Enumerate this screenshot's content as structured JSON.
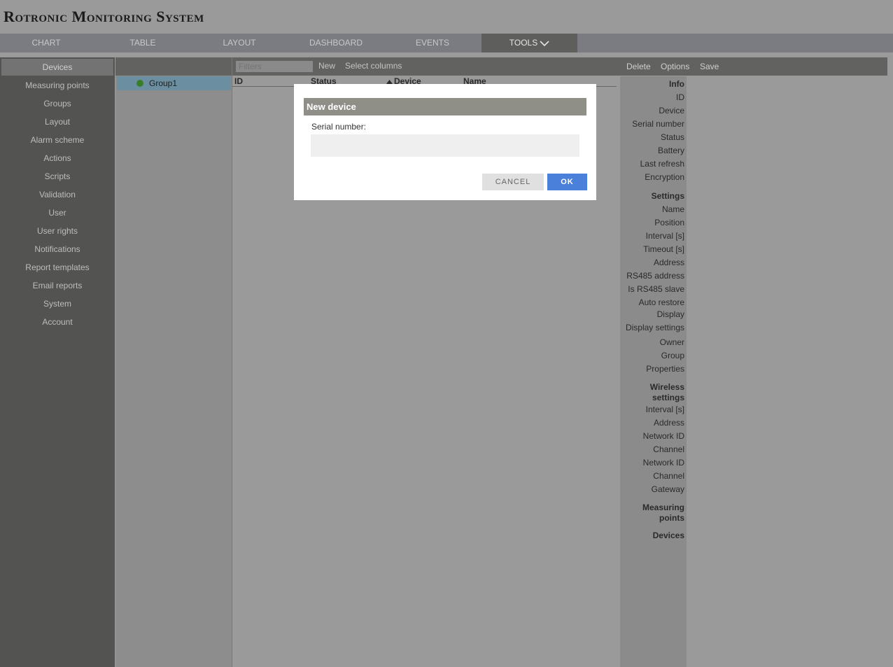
{
  "app_title": "Rotronic Monitoring System",
  "nav": {
    "tabs": [
      "CHART",
      "TABLE",
      "LAYOUT",
      "DASHBOARD",
      "EVENTS",
      "TOOLS"
    ]
  },
  "sidebar": {
    "items": [
      "Devices",
      "Measuring points",
      "Groups",
      "Layout",
      "Alarm scheme",
      "Actions",
      "Scripts",
      "Validation",
      "User",
      "User rights",
      "Notifications",
      "Report templates",
      "Email reports",
      "System",
      "Account"
    ]
  },
  "groups": {
    "items": [
      "Group1"
    ]
  },
  "table": {
    "filters_placeholder": "Filters",
    "new_label": "New",
    "select_columns_label": "Select columns",
    "columns": [
      "ID",
      "Status",
      "Device",
      "Name"
    ]
  },
  "props": {
    "toolbar": [
      "Delete",
      "Options",
      "Save"
    ],
    "labels": [
      "Info",
      "ID",
      "Device",
      "Serial number",
      "Status",
      "Battery",
      "Last refresh",
      "Encryption",
      "Settings",
      "Name",
      "Position",
      "Interval [s]",
      "Timeout [s]",
      "Address",
      "RS485 address",
      "Is RS485 slave",
      "Auto restore",
      "Display",
      "Display settings",
      "Owner",
      "Group",
      "Properties",
      "Wireless settings",
      "Interval [s]",
      "Address",
      "Network ID",
      "Channel",
      "Network ID",
      "Channel",
      "Gateway",
      "Measuring points",
      "Devices"
    ]
  },
  "modal": {
    "title": "New device",
    "serial_label": "Serial number:",
    "serial_value": "",
    "cancel_label": "CANCEL",
    "ok_label": "OK"
  },
  "colors": {
    "ok_button": "#4a80d9",
    "group_dot": "#3a7e2a"
  }
}
